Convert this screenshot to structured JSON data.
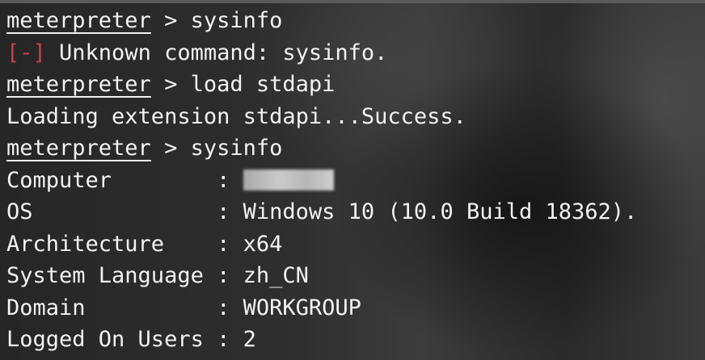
{
  "terminal": {
    "prompt": "meterpreter",
    "prompt_sep": " > ",
    "lines": [
      {
        "type": "command",
        "text": "sysinfo"
      },
      {
        "type": "error",
        "marker": "[-]",
        "text": " Unknown command: sysinfo."
      },
      {
        "type": "command",
        "text": "load stdapi"
      },
      {
        "type": "output",
        "text": "Loading extension stdapi...Success."
      },
      {
        "type": "command",
        "text": "sysinfo"
      }
    ],
    "sysinfo": {
      "computer_label": "Computer        ",
      "sep": ": ",
      "os_label": "OS              ",
      "os_value": "Windows 10 (10.0 Build 18362).",
      "arch_label": "Architecture    ",
      "arch_value": "x64",
      "lang_label": "System Language ",
      "lang_value": "zh_CN",
      "domain_label": "Domain          ",
      "domain_value": "WORKGROUP",
      "users_label": "Logged On Users ",
      "users_value": "2"
    }
  },
  "colors": {
    "text": "#f2f2f2",
    "error": "#c8404a"
  }
}
